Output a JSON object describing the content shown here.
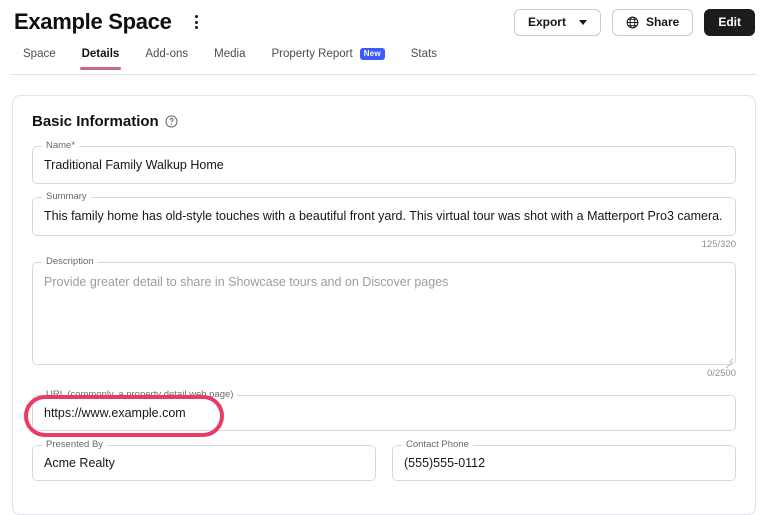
{
  "header": {
    "title": "Example Space",
    "kebab_label": "More options",
    "actions": {
      "export_label": "Export",
      "share_label": "Share",
      "edit_label": "Edit"
    }
  },
  "tabs": [
    {
      "label": "Space",
      "active": false,
      "badge": ""
    },
    {
      "label": "Details",
      "active": true,
      "badge": ""
    },
    {
      "label": "Add-ons",
      "active": false,
      "badge": ""
    },
    {
      "label": "Media",
      "active": false,
      "badge": ""
    },
    {
      "label": "Property Report",
      "active": false,
      "badge": "New"
    },
    {
      "label": "Stats",
      "active": false,
      "badge": ""
    }
  ],
  "card": {
    "title": "Basic Information",
    "fields": {
      "name": {
        "label": "Name*",
        "value": "Traditional Family Walkup Home"
      },
      "summary": {
        "label": "Summary",
        "value": "This family home has old-style touches with a beautiful front yard. This virtual tour was shot with a Matterport Pro3 camera.",
        "counter": "125/320"
      },
      "description": {
        "label": "Description",
        "value": "",
        "placeholder": "Provide greater detail to share in Showcase tours and on Discover pages",
        "counter": "0/2500"
      },
      "url": {
        "label": "URL (commonly, a property detail web page)",
        "value": "https://www.example.com"
      },
      "presented_by": {
        "label": "Presented By",
        "value": "Acme Realty"
      },
      "contact_phone": {
        "label": "Contact Phone",
        "value": "(555)555-0112"
      }
    }
  },
  "colors": {
    "accent_tab_underline": "#c4688b",
    "badge_new": "#3d5afe",
    "annotation": "#ea3b66",
    "edit_button": "#1b1c1e",
    "border": "#d6d8dc"
  }
}
